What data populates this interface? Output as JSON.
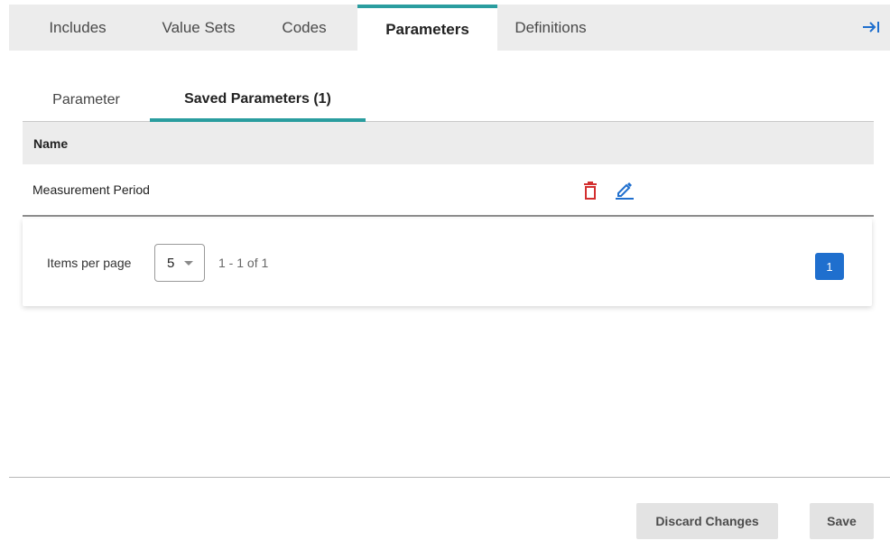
{
  "top_tabs": [
    {
      "label": "Includes"
    },
    {
      "label": "Value Sets"
    },
    {
      "label": "Codes"
    },
    {
      "label": "Parameters"
    },
    {
      "label": "Definitions"
    }
  ],
  "active_top_tab": "Parameters",
  "sub_tabs": [
    {
      "label": "Parameter"
    },
    {
      "label": "Saved Parameters (1)"
    }
  ],
  "table": {
    "columns": [
      "Name"
    ],
    "rows": [
      {
        "name": "Measurement Period"
      }
    ]
  },
  "pagination": {
    "items_per_page_label": "Items per page",
    "items_per_page_value": "5",
    "range_text": "1 - 1 of 1",
    "current_page": "1"
  },
  "footer": {
    "discard_label": "Discard Changes",
    "save_label": "Save"
  },
  "colors": {
    "accent": "#2a9d9f",
    "delete_icon": "#d32f2f",
    "edit_icon": "#1f6fce",
    "page_button": "#1f6fce"
  },
  "icons": {
    "collapse": "arrow-right-to-bar-icon",
    "delete": "trash-icon",
    "edit": "pencil-icon"
  }
}
